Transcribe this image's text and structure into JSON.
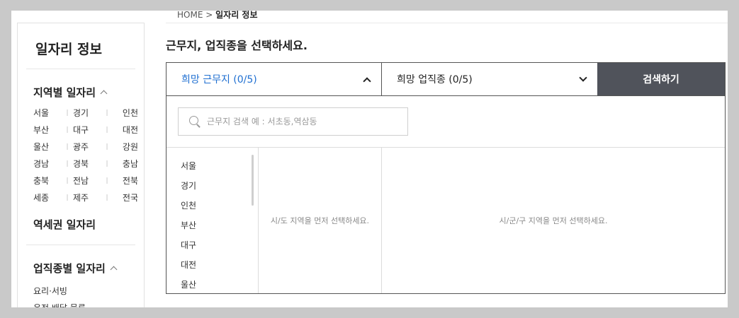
{
  "breadcrumb": {
    "home": "HOME",
    "separator": ">",
    "current": "일자리 정보"
  },
  "sidebar": {
    "title": "일자리 정보",
    "region_section": "지역별 일자리",
    "regions": [
      "서울",
      "경기",
      "인천",
      "부산",
      "대구",
      "대전",
      "울산",
      "광주",
      "강원",
      "경남",
      "경북",
      "충남",
      "충북",
      "전남",
      "전북",
      "세종",
      "제주",
      "전국"
    ],
    "station_section": "역세권 일자리",
    "job_section": "업직종별 일자리",
    "jobs": [
      "요리·서빙",
      "운전·배달·물류"
    ]
  },
  "main": {
    "heading": "근무지, 업직종을 선택하세요.",
    "location_selector": "희망 근무지 (0/5)",
    "job_selector": "희망 업직종 (0/5)",
    "search_button": "검색하기",
    "search_placeholder": "근무지 검색 예 : 서초동,역삼동",
    "provinces": [
      "서울",
      "경기",
      "인천",
      "부산",
      "대구",
      "대전",
      "울산"
    ],
    "col2_hint": "시/도 지역을 먼저 선택하세요.",
    "col3_hint": "시/군/구 지역을 먼저 선택하세요."
  },
  "colors": {
    "accent": "#1f6fd1",
    "button_bg": "#50535b",
    "panel_border": "#555555"
  }
}
